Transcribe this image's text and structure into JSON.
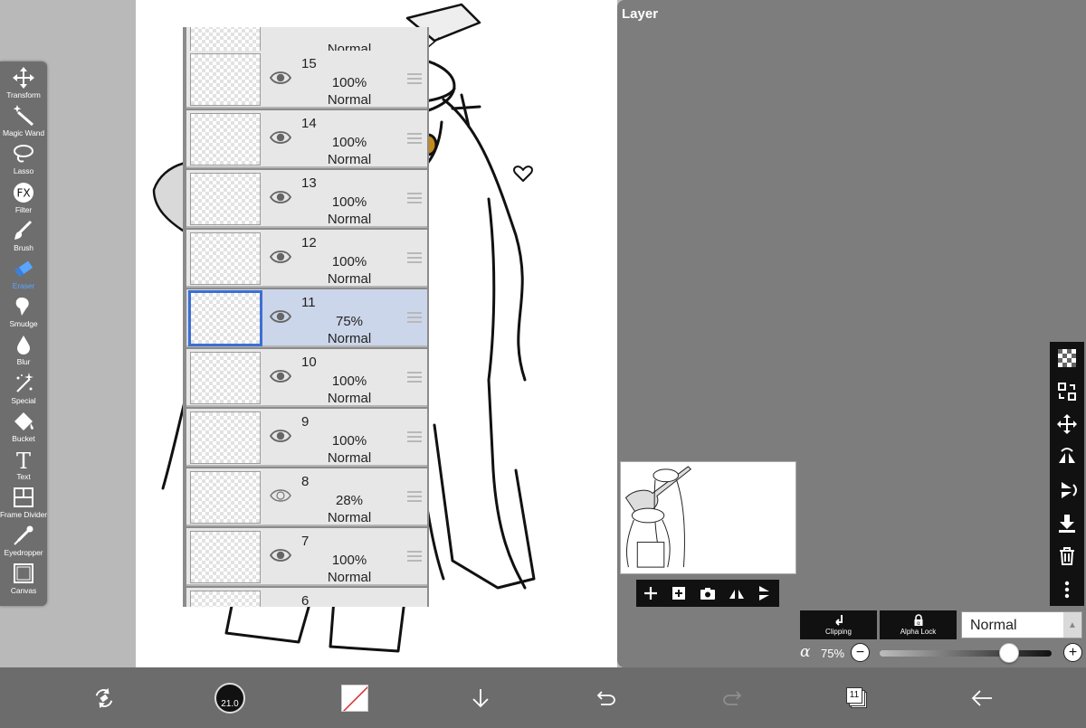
{
  "toolbar": {
    "tools": [
      {
        "label": "Transform",
        "icon": "move-arrows-icon"
      },
      {
        "label": "Magic Wand",
        "icon": "magic-wand-icon"
      },
      {
        "label": "Lasso",
        "icon": "lasso-icon"
      },
      {
        "label": "Filter",
        "icon": "fx-icon"
      },
      {
        "label": "Brush",
        "icon": "brush-icon"
      },
      {
        "label": "Eraser",
        "icon": "eraser-icon"
      },
      {
        "label": "Smudge",
        "icon": "smudge-icon"
      },
      {
        "label": "Blur",
        "icon": "blur-drop-icon"
      },
      {
        "label": "Special",
        "icon": "special-sparkle-icon"
      },
      {
        "label": "Bucket",
        "icon": "bucket-icon"
      },
      {
        "label": "Text",
        "icon": "text-icon"
      },
      {
        "label": "Frame Divider",
        "icon": "frame-divider-icon"
      },
      {
        "label": "Eyedropper",
        "icon": "eyedropper-icon"
      },
      {
        "label": "Canvas",
        "icon": "canvas-icon"
      }
    ],
    "active": "Eraser",
    "active_color": "#5aa6ff"
  },
  "layer_panel": {
    "title": "Layer",
    "top_partial_mode": "Normal",
    "layers": [
      {
        "number": "15",
        "opacity": "100%",
        "mode": "Normal",
        "visible": true,
        "selected": false
      },
      {
        "number": "14",
        "opacity": "100%",
        "mode": "Normal",
        "visible": true,
        "selected": false
      },
      {
        "number": "13",
        "opacity": "100%",
        "mode": "Normal",
        "visible": true,
        "selected": false
      },
      {
        "number": "12",
        "opacity": "100%",
        "mode": "Normal",
        "visible": true,
        "selected": false
      },
      {
        "number": "11",
        "opacity": "75%",
        "mode": "Normal",
        "visible": true,
        "selected": true
      },
      {
        "number": "10",
        "opacity": "100%",
        "mode": "Normal",
        "visible": true,
        "selected": false
      },
      {
        "number": "9",
        "opacity": "100%",
        "mode": "Normal",
        "visible": true,
        "selected": false
      },
      {
        "number": "8",
        "opacity": "28%",
        "mode": "Normal",
        "visible": true,
        "selected": false
      },
      {
        "number": "7",
        "opacity": "100%",
        "mode": "Normal",
        "visible": true,
        "selected": false
      }
    ],
    "bottom_partial_number": "6",
    "selected_color": "#3c6fd1",
    "clipping_label": "Clipping",
    "alpha_lock_label": "Alpha Lock",
    "blend_mode": "Normal",
    "alpha_symbol": "α",
    "alpha_value": "75%",
    "alpha_fraction": 0.75
  },
  "bottom_bar": {
    "brush_size": "21.0",
    "layer_count": "11"
  }
}
